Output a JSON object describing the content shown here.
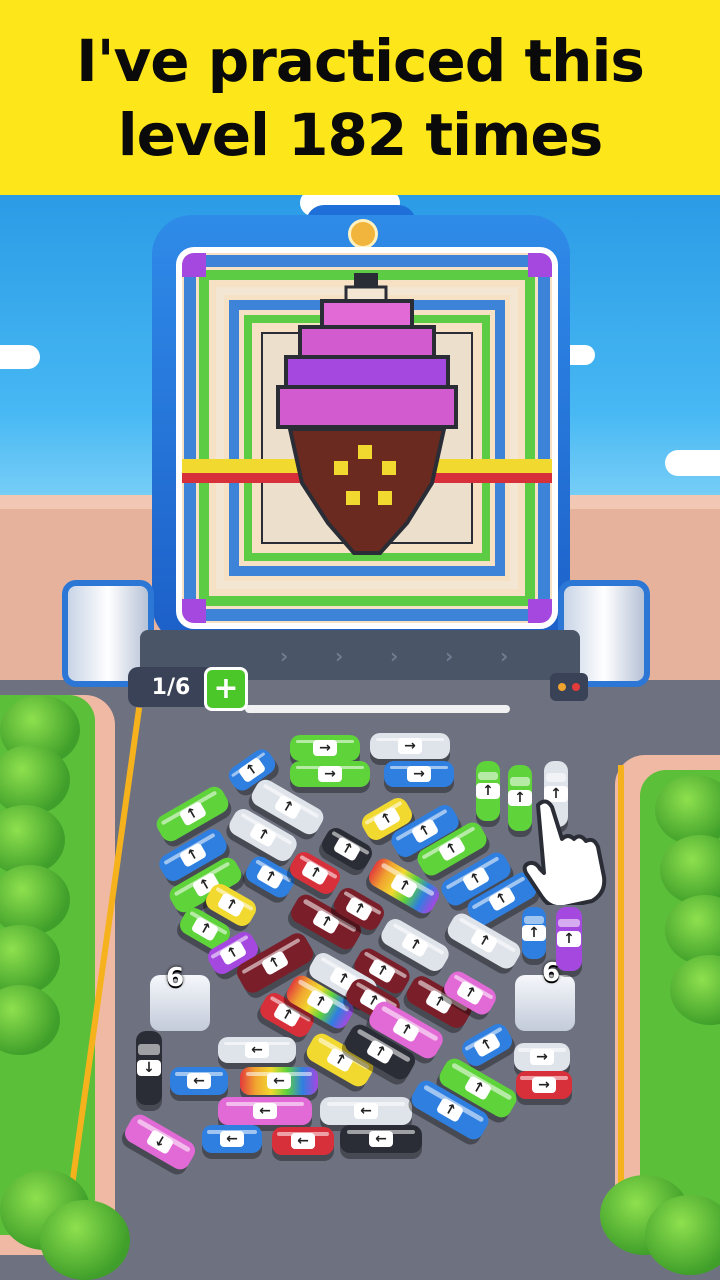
{
  "banner": {
    "line1": "I've practiced this",
    "line2": "level 182 times",
    "background": "#fde61a"
  },
  "hud": {
    "progress_text": "1/6",
    "add_button_label": "+"
  },
  "depots": [
    {
      "count": "6"
    },
    {
      "count": "6"
    }
  ],
  "colors": {
    "green": "#5ed33a",
    "blue": "#2f7fe0",
    "white": "#dfe4ea",
    "black": "#2a2d36",
    "maroon": "#7a1f2a",
    "red": "#d8303a",
    "yellow": "#f1d930",
    "purple": "#a548e0",
    "pink": "#e26ad6",
    "rainbow": "rainbow"
  },
  "artwork": "pixel ice cream cone",
  "buses": [
    {
      "color": "green",
      "dir": "right"
    },
    {
      "color": "white",
      "dir": "right"
    },
    {
      "color": "blue",
      "dir": "up"
    },
    {
      "color": "green",
      "dir": "right"
    },
    {
      "color": "blue",
      "dir": "right"
    },
    {
      "color": "green",
      "dir": "up"
    },
    {
      "color": "green",
      "dir": "up"
    },
    {
      "color": "white",
      "dir": "up"
    },
    {
      "color": "green",
      "dir": "up"
    },
    {
      "color": "white",
      "dir": "up"
    },
    {
      "color": "yellow",
      "dir": "up"
    },
    {
      "color": "blue",
      "dir": "up"
    },
    {
      "color": "blue",
      "dir": "up"
    },
    {
      "color": "white",
      "dir": "up"
    },
    {
      "color": "black",
      "dir": "up"
    },
    {
      "color": "green",
      "dir": "up"
    },
    {
      "color": "blue",
      "dir": "up"
    },
    {
      "color": "green",
      "dir": "up"
    },
    {
      "color": "blue",
      "dir": "up"
    },
    {
      "color": "red",
      "dir": "up"
    },
    {
      "color": "rainbow",
      "dir": "up"
    },
    {
      "color": "blue",
      "dir": "up"
    },
    {
      "color": "yellow",
      "dir": "up"
    },
    {
      "color": "green",
      "dir": "up"
    },
    {
      "color": "maroon",
      "dir": "up"
    },
    {
      "color": "maroon",
      "dir": "up"
    },
    {
      "color": "blue",
      "dir": "up"
    },
    {
      "color": "purple",
      "dir": "up"
    },
    {
      "color": "purple",
      "dir": "up"
    },
    {
      "color": "maroon",
      "dir": "up"
    },
    {
      "color": "white",
      "dir": "up"
    },
    {
      "color": "white",
      "dir": "up"
    },
    {
      "color": "maroon",
      "dir": "up"
    },
    {
      "color": "white",
      "dir": "up"
    },
    {
      "color": "maroon",
      "dir": "up"
    },
    {
      "color": "pink",
      "dir": "up"
    },
    {
      "color": "red",
      "dir": "up"
    },
    {
      "color": "rainbow",
      "dir": "up"
    },
    {
      "color": "maroon",
      "dir": "up"
    },
    {
      "color": "pink",
      "dir": "up"
    },
    {
      "color": "black",
      "dir": "down"
    },
    {
      "color": "white",
      "dir": "left"
    },
    {
      "color": "yellow",
      "dir": "up"
    },
    {
      "color": "black",
      "dir": "up"
    },
    {
      "color": "blue",
      "dir": "up"
    },
    {
      "color": "white",
      "dir": "right"
    },
    {
      "color": "blue",
      "dir": "left"
    },
    {
      "color": "rainbow",
      "dir": "left"
    },
    {
      "color": "green",
      "dir": "up"
    },
    {
      "color": "red",
      "dir": "right"
    },
    {
      "color": "pink",
      "dir": "left"
    },
    {
      "color": "white",
      "dir": "left"
    },
    {
      "color": "blue",
      "dir": "up"
    },
    {
      "color": "pink",
      "dir": "down"
    },
    {
      "color": "blue",
      "dir": "left"
    },
    {
      "color": "red",
      "dir": "left"
    },
    {
      "color": "black",
      "dir": "left"
    }
  ]
}
